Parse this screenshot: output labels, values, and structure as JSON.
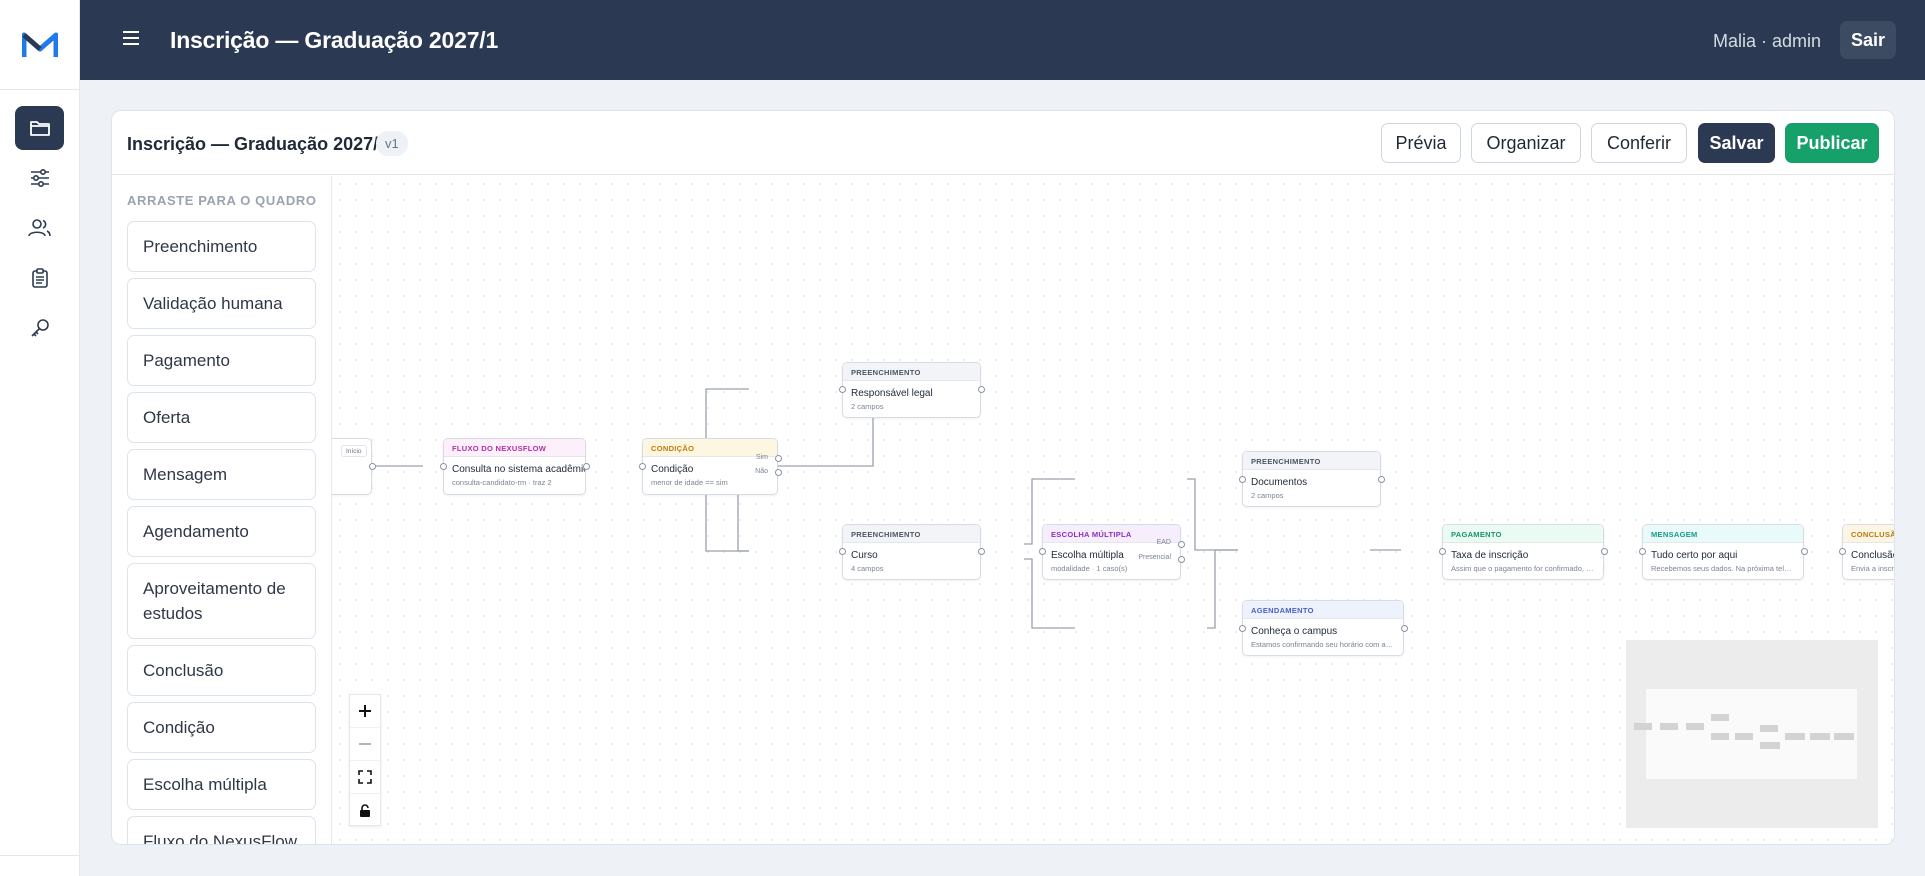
{
  "app": {
    "title": "Inscrição — Graduação 2027/1",
    "user": "Malia · admin",
    "logout": "Sair"
  },
  "rail": {
    "logo": "M",
    "icons": [
      "folder-icon",
      "sliders-icon",
      "users-icon",
      "clipboard-icon",
      "key-icon"
    ],
    "active_index": 0
  },
  "editor": {
    "name": "Inscrição — Graduação 2027/1",
    "version": "v1",
    "buttons": {
      "preview": "Prévia",
      "organize": "Organizar",
      "check": "Conferir",
      "save": "Salvar",
      "publish": "Publicar"
    }
  },
  "palette": {
    "label": "ARRASTE PARA O QUADRO",
    "items": [
      "Preenchimento",
      "Validação humana",
      "Pagamento",
      "Oferta",
      "Mensagem",
      "Agendamento",
      "Aproveitamento de estudos",
      "Conclusão",
      "Condição",
      "Escolha múltipla",
      "Fluxo do NexusFlow"
    ]
  },
  "nodes": {
    "start": {
      "badge": "Início"
    },
    "nexus": {
      "type": "FLUXO DO NEXUSFLOW",
      "title": "Consulta no sistema acadêmico",
      "sub": "consulta-candidato-rm · traz 2"
    },
    "cond": {
      "type": "CONDIÇÃO",
      "title": "Condição",
      "sub": "menor de idade == sim",
      "yes": "Sim",
      "no": "Não"
    },
    "guardian": {
      "type": "PREENCHIMENTO",
      "title": "Responsável legal",
      "sub": "2 campos"
    },
    "course": {
      "type": "PREENCHIMENTO",
      "title": "Curso",
      "sub": "4 campos"
    },
    "choice": {
      "type": "ESCOLHA MÚLTIPLA",
      "title": "Escolha múltipla",
      "sub": "modalidade · 1 caso(s)",
      "opt1": "EAD",
      "opt2": "Presencial"
    },
    "docs": {
      "type": "PREENCHIMENTO",
      "title": "Documentos",
      "sub": "2 campos"
    },
    "campus": {
      "type": "AGENDAMENTO",
      "title": "Conheça o campus",
      "sub": "Estamos confirmando seu horário com a e..."
    },
    "fee": {
      "type": "PAGAMENTO",
      "title": "Taxa de inscrição",
      "sub": "Assim que o pagamento for confirmado, s..."
    },
    "msg": {
      "type": "MENSAGEM",
      "title": "Tudo certo por aqui",
      "sub": "Recebemos seus dados. Na próxima tela v..."
    },
    "end": {
      "type": "CONCLUSÃO",
      "title": "Conclusão",
      "sub": "Envia a inscri"
    }
  }
}
